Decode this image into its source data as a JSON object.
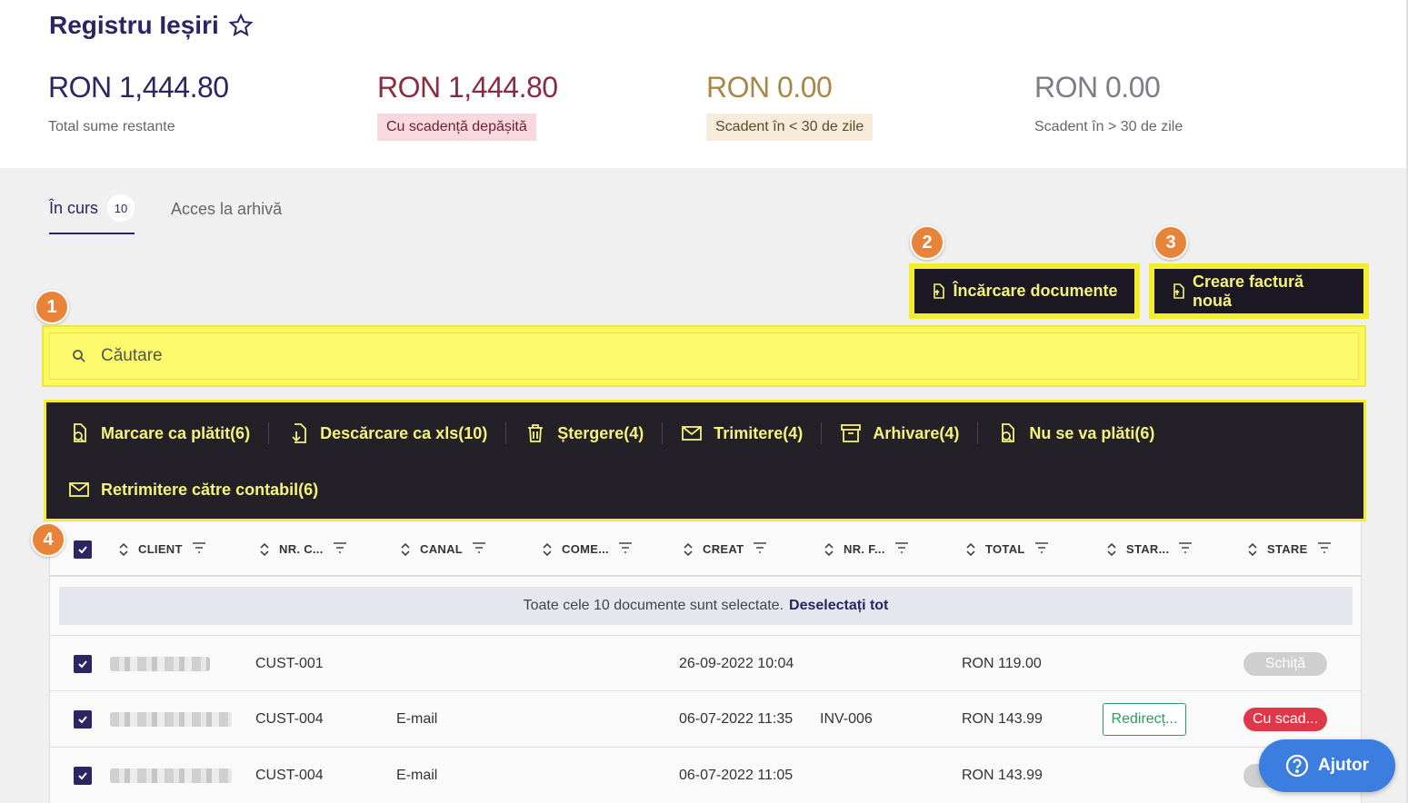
{
  "page": {
    "title": "Registru Ieșiri"
  },
  "stats": [
    {
      "amount": "RON 1,444.80",
      "label": "Total sume restante"
    },
    {
      "amount": "RON 1,444.80",
      "label": "Cu scadență depășită"
    },
    {
      "amount": "RON 0.00",
      "label": "Scadent în < 30 de zile"
    },
    {
      "amount": "RON 0.00",
      "label": "Scadent în > 30 de zile"
    }
  ],
  "tabs": [
    {
      "label": "În curs",
      "count": "10"
    },
    {
      "label": "Acces la arhivă"
    }
  ],
  "markers": [
    "1",
    "2",
    "3",
    "4"
  ],
  "actions": {
    "upload_label": "Încărcare documente",
    "create_label": "Creare factură nouă"
  },
  "search": {
    "placeholder": "Căutare"
  },
  "bulk_actions": [
    {
      "label": "Marcare ca plătit(6)",
      "icon": "pay-icon"
    },
    {
      "label": "Descărcare ca xls(10)",
      "icon": "download-icon"
    },
    {
      "label": "Ștergere(4)",
      "icon": "trash-icon"
    },
    {
      "label": "Trimitere(4)",
      "icon": "mail-icon"
    },
    {
      "label": "Arhivare(4)",
      "icon": "archive-icon"
    },
    {
      "label": "Nu se va plăti(6)",
      "icon": "pay-icon"
    },
    {
      "label": "Retrimitere către contabil(6)",
      "icon": "mail-icon"
    }
  ],
  "table": {
    "columns": [
      "CLIENT",
      "NR. C...",
      "CANAL",
      "COME...",
      "CREAT",
      "NR. F...",
      "TOTAL",
      "STAR...",
      "STARE"
    ],
    "selection_text": "Toate cele 10 documente sunt selectate.",
    "deselect_label": "Deselectați tot",
    "rows": [
      {
        "nr_client": "CUST-001",
        "canal": "",
        "creat": "26-09-2022 10:04",
        "nr_factura": "",
        "total": "RON 119.00",
        "start": "",
        "stare": "Schiță",
        "stare_type": "draft"
      },
      {
        "nr_client": "CUST-004",
        "canal": "E-mail",
        "creat": "06-07-2022 11:35",
        "nr_factura": "INV-006",
        "total": "RON 143.99",
        "start": "Redirecț...",
        "stare": "Cu scad...",
        "stare_type": "overdue"
      },
      {
        "nr_client": "CUST-004",
        "canal": "E-mail",
        "creat": "06-07-2022 11:05",
        "nr_factura": "",
        "total": "RON 143.99",
        "start": "",
        "stare": "",
        "stare_type": "draft"
      }
    ]
  },
  "help": {
    "label": "Ajutor"
  },
  "colors": {
    "brand": "#2b2561",
    "highlight": "#f3ed2d",
    "dark": "#242028",
    "marker": "#e8843a",
    "help": "#3c7de0"
  }
}
